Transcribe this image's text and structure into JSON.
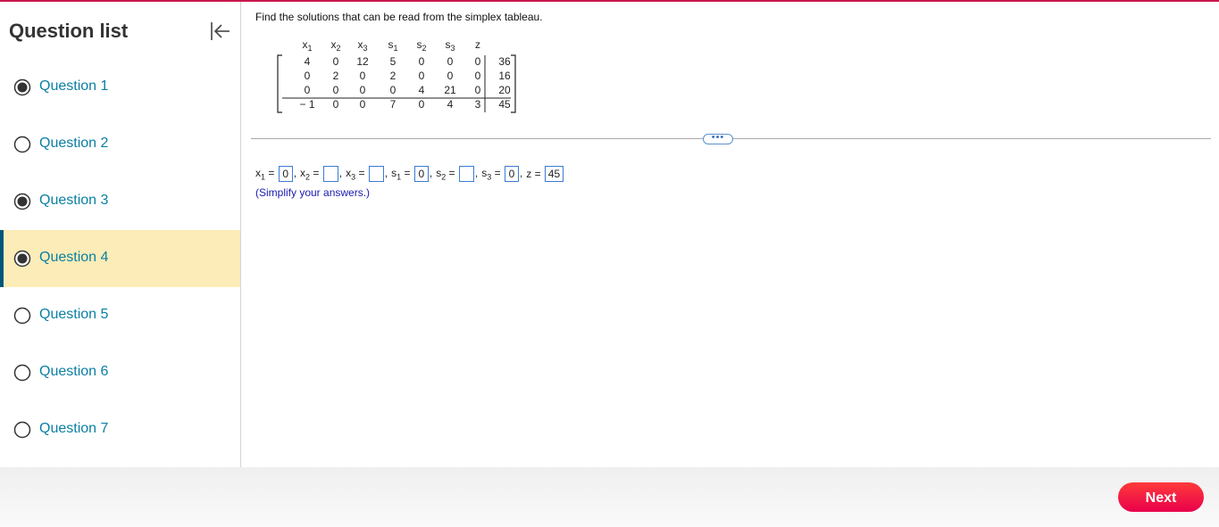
{
  "sidebar": {
    "title": "Question list",
    "items": [
      {
        "label": "Question 1",
        "answered": true,
        "active": false
      },
      {
        "label": "Question 2",
        "answered": false,
        "active": false
      },
      {
        "label": "Question 3",
        "answered": true,
        "active": false
      },
      {
        "label": "Question 4",
        "answered": true,
        "active": true
      },
      {
        "label": "Question 5",
        "answered": false,
        "active": false
      },
      {
        "label": "Question 6",
        "answered": false,
        "active": false
      },
      {
        "label": "Question 7",
        "answered": false,
        "active": false
      }
    ]
  },
  "main": {
    "prompt": "Find the solutions that can be read from the simplex tableau.",
    "tableau": {
      "headers": [
        {
          "base": "x",
          "sub": "1"
        },
        {
          "base": "x",
          "sub": "2"
        },
        {
          "base": "x",
          "sub": "3"
        },
        {
          "base": "s",
          "sub": "1"
        },
        {
          "base": "s",
          "sub": "2"
        },
        {
          "base": "s",
          "sub": "3"
        },
        {
          "base": "z",
          "sub": ""
        }
      ],
      "rows": [
        [
          "4",
          "0",
          "12",
          "5",
          "0",
          "0",
          "0",
          "36"
        ],
        [
          "0",
          "2",
          "0",
          "2",
          "0",
          "0",
          "0",
          "16"
        ],
        [
          "0",
          "0",
          "0",
          "0",
          "4",
          "21",
          "0",
          "20"
        ],
        [
          "− 1",
          "0",
          "0",
          "7",
          "0",
          "4",
          "3",
          "45"
        ]
      ]
    },
    "more_label": "•••",
    "answers": [
      {
        "base": "x",
        "sub": "1",
        "eq": " = ",
        "value": "0",
        "sep": ","
      },
      {
        "base": "x",
        "sub": "2",
        "eq": " = ",
        "value": "",
        "sep": ","
      },
      {
        "base": "x",
        "sub": "3",
        "eq": " = ",
        "value": "",
        "sep": ","
      },
      {
        "base": "s",
        "sub": "1",
        "eq": " = ",
        "value": "0",
        "sep": ","
      },
      {
        "base": "s",
        "sub": "2",
        "eq": " = ",
        "value": "",
        "sep": ","
      },
      {
        "base": "s",
        "sub": "3",
        "eq": " = ",
        "value": "0",
        "sep": ","
      },
      {
        "base": "z",
        "sub": "",
        "eq": " = ",
        "value": "45",
        "sep": ""
      }
    ],
    "hint": "(Simplify your answers.)"
  },
  "footer": {
    "next_label": "Next"
  },
  "colors": {
    "accent": "#c8174f",
    "link": "#0a7fa3",
    "active_bg": "#fbecb8",
    "active_bar": "#00567a",
    "next_button": "#f0114a"
  },
  "icons": {
    "collapse": "collapse-left-icon",
    "radio_answered": "radio-filled-icon",
    "radio_unanswered": "radio-empty-icon"
  }
}
